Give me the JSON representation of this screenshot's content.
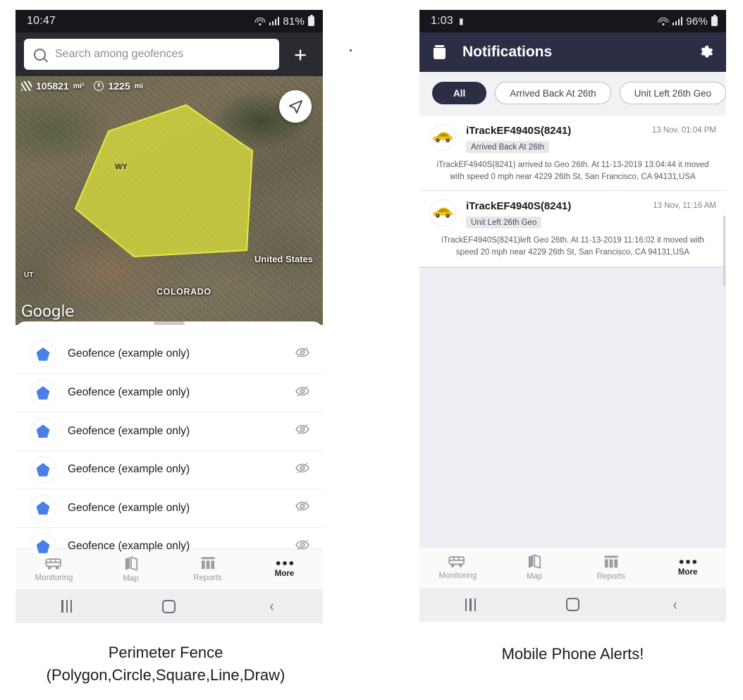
{
  "left_phone": {
    "status_bar": {
      "time": "10:47",
      "battery": "81%",
      "wifi_icon": "wifi-icon",
      "signal_icon": "signal-bars-icon",
      "battery_icon": "battery-icon"
    },
    "search": {
      "placeholder": "Search among geofences",
      "icon": "search-icon",
      "add_label": "+"
    },
    "map": {
      "area_value": "105821",
      "area_unit": "mi²",
      "area_icon": "area-hatch-icon",
      "perimeter_value": "1225",
      "perimeter_unit": "mi",
      "perimeter_icon": "clock-icon",
      "locate_icon": "navigate-arrow-icon",
      "labels": {
        "country": "United States",
        "state": "COLORADO",
        "state_abbr_ut": "UT",
        "state_abbr_wy": "WY"
      },
      "watermark": "Google",
      "polygon_fill": "#e0e83a"
    },
    "geofences": [
      {
        "label": "Geofence (example only)",
        "icon": "pentagon-icon",
        "visibility_icon": "eye-off-icon"
      },
      {
        "label": "Geofence (example only)",
        "icon": "pentagon-icon",
        "visibility_icon": "eye-off-icon"
      },
      {
        "label": "Geofence (example only)",
        "icon": "pentagon-icon",
        "visibility_icon": "eye-off-icon"
      },
      {
        "label": "Geofence (example only)",
        "icon": "pentagon-icon",
        "visibility_icon": "eye-off-icon"
      },
      {
        "label": "Geofence (example only)",
        "icon": "pentagon-icon",
        "visibility_icon": "eye-off-icon"
      },
      {
        "label": "Geofence (example only)",
        "icon": "pentagon-icon",
        "visibility_icon": "eye-off-icon"
      }
    ]
  },
  "right_phone": {
    "status_bar": {
      "time": "1:03",
      "battery": "96%",
      "message_icon": "message-icon",
      "wifi_icon": "wifi-icon",
      "signal_icon": "signal-bars-icon",
      "battery_icon": "battery-icon"
    },
    "app_bar": {
      "title": "Notifications",
      "delete_icon": "trash-icon",
      "settings_icon": "gear-icon"
    },
    "filter_chips": [
      {
        "label": "All",
        "selected": true
      },
      {
        "label": "Arrived Back At 26th",
        "selected": false
      },
      {
        "label": "Unit Left 26th Geo",
        "selected": false
      }
    ],
    "notifications": [
      {
        "device": "iTrackEF4940S(8241)",
        "tag": "Arrived Back At 26th",
        "time": "13 Nov, 01:04 PM",
        "body_line1": "iTrackEF4940S(8241) arrived to Geo 26th.      At 11-13-2019 13:04:44 it moved",
        "body_line2": "with speed 0 mph near 4229 26th St, San Francisco, CA 94131,USA",
        "avatar_icon": "yellow-car-icon"
      },
      {
        "device": "iTrackEF4940S(8241)",
        "tag": "Unit Left 26th Geo",
        "time": "13 Nov, 11:16 AM",
        "body_line1": "iTrackEF4940S(8241)left Geo 26th.      At 11-13-2019 11:16:02 it moved with",
        "body_line2": "speed 20 mph near 4229 26th St, San Francisco, CA 94131,USA",
        "avatar_icon": "yellow-car-icon"
      }
    ]
  },
  "bottom_nav": [
    {
      "label": "Monitoring",
      "icon": "van-icon",
      "active": false
    },
    {
      "label": "Map",
      "icon": "map-icon",
      "active": false
    },
    {
      "label": "Reports",
      "icon": "reports-icon",
      "active": false
    },
    {
      "label": "More",
      "icon": "more-dots-icon",
      "active": true
    }
  ],
  "system_nav": {
    "recents_icon": "recents-icon",
    "home_icon": "home-icon",
    "back_icon": "back-icon"
  },
  "captions": {
    "left_line1": "Perimeter Fence",
    "left_line2": "(Polygon,Circle,Square,Line,Draw)",
    "right_line1": "Mobile Phone Alerts!"
  },
  "colors": {
    "appbar_navy": "#2b2e45",
    "search_bar_dark": "#2b2a31",
    "geofence_blue": "#4a7ee8",
    "polygon_yellow": "#e0e83a"
  }
}
